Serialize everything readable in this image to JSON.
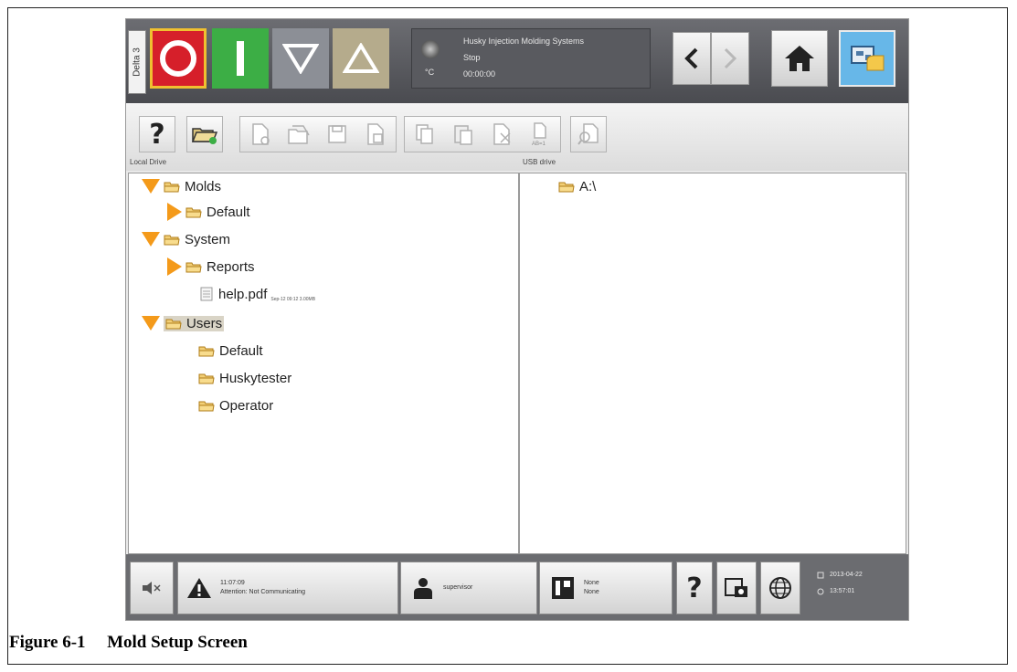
{
  "machine": {
    "station_label": "Delta 3",
    "company": "Husky Injection Molding Systems",
    "state": "Stop",
    "timer": "00:00:00",
    "temp_unit": "°C"
  },
  "panes": {
    "left_label": "Local Drive",
    "right_label": "USB drive"
  },
  "tree": {
    "molds": "Molds",
    "molds_default": "Default",
    "system": "System",
    "reports": "Reports",
    "help_pdf": "help.pdf",
    "help_pdf_meta": "Sep-12 09:12 3.00MB",
    "users": "Users",
    "users_default": "Default",
    "huskytester": "Huskytester",
    "operator": "Operator"
  },
  "usb": {
    "drive": "A:\\"
  },
  "statusbar": {
    "alarm_time": "11:07:09",
    "alarm_text": "Attention: Not Communicating",
    "user": "supervisor",
    "mold_line1": "None",
    "mold_line2": "None",
    "date": "2013-04-22",
    "time": "13:57:01"
  },
  "caption": {
    "number": "Figure 6-1",
    "title": "Mold Setup Screen"
  },
  "colors": {
    "stop_red": "#d61f2a",
    "start_green": "#3cae45",
    "expander_orange": "#f49a1a",
    "screens_blue": "#67b7e8"
  }
}
